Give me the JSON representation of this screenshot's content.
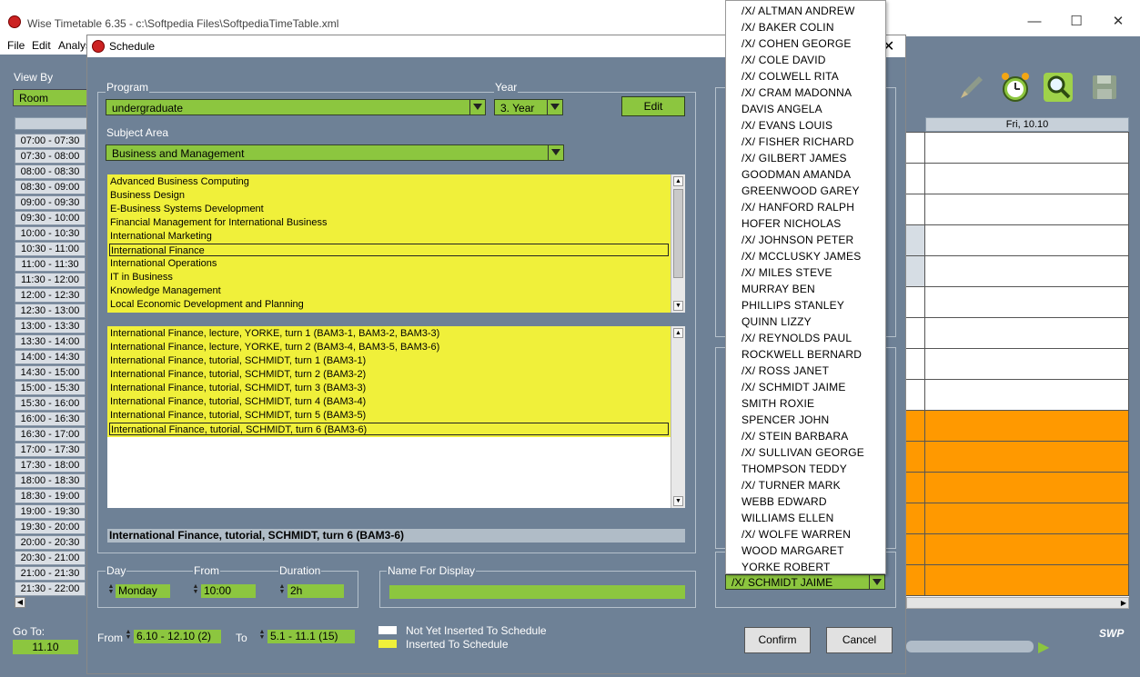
{
  "main_window": {
    "title": "Wise Timetable 6.35 - c:\\Softpedia Files\\SoftpediaTimeTable.xml",
    "menu": [
      "File",
      "Edit",
      "Analys"
    ],
    "view_by_label": "View By",
    "view_by_value": "Room",
    "time_slots": [
      "07:00 - 07:30",
      "07:30 - 08:00",
      "08:00 - 08:30",
      "08:30 - 09:00",
      "09:00 - 09:30",
      "09:30 - 10:00",
      "10:00 - 10:30",
      "10:30 - 11:00",
      "11:00 - 11:30",
      "11:30 - 12:00",
      "12:00 - 12:30",
      "12:30 - 13:00",
      "13:00 - 13:30",
      "13:30 - 14:00",
      "14:00 - 14:30",
      "14:30 - 15:00",
      "15:00 - 15:30",
      "15:30 - 16:00",
      "16:00 - 16:30",
      "16:30 - 17:00",
      "17:00 - 17:30",
      "17:30 - 18:00",
      "18:00 - 18:30",
      "18:30 - 19:00",
      "19:00 - 19:30",
      "19:30 - 20:00",
      "20:00 - 20:30",
      "20:30 - 21:00",
      "21:00 - 21:30",
      "21:30 - 22:00"
    ],
    "day_header": "Fri, 10.10",
    "goto_label": "Go To:",
    "goto_value": "11.10",
    "logo": "SWP",
    "colors": {
      "accent_green": "#8cc63f",
      "scheduled_orange": "#ff9900",
      "background": "#6f8196"
    }
  },
  "dialog": {
    "title": "Schedule",
    "program_label": "Program",
    "program_value": "undergraduate",
    "year_label": "Year",
    "year_value": "3. Year",
    "edit_label": "Edit",
    "subject_area_label": "Subject Area",
    "subject_area_value": "Business and Management",
    "courses": [
      "Advanced Business Computing",
      "Business Design",
      "E-Business Systems Development",
      "Financial Management for International Business",
      "International Marketing",
      "International Finance",
      "International Operations",
      "IT in Business",
      "Knowledge Management",
      "Local Economic Development and Planning"
    ],
    "selected_course": "International Finance",
    "activities": [
      "International Finance, lecture, YORKE, turn 1 (BAM3-1, BAM3-2, BAM3-3)",
      "International Finance, lecture, YORKE, turn 2 (BAM3-4, BAM3-5, BAM3-6)",
      "International Finance, tutorial, SCHMIDT, turn 1 (BAM3-1)",
      "International Finance, tutorial, SCHMIDT, turn 2 (BAM3-2)",
      "International Finance, tutorial, SCHMIDT, turn 3 (BAM3-3)",
      "International Finance, tutorial, SCHMIDT, turn 4 (BAM3-4)",
      "International Finance, tutorial, SCHMIDT, turn 5 (BAM3-5)",
      "International Finance, tutorial, SCHMIDT, turn 6 (BAM3-6)"
    ],
    "selected_activity": "International Finance, tutorial, SCHMIDT, turn 6 (BAM3-6)",
    "day_label": "Day",
    "day_value": "Monday",
    "from_label": "From",
    "from_value": "10:00",
    "duration_label": "Duration",
    "duration_value": "2h",
    "name_for_display_label": "Name For Display",
    "name_for_display_value": "",
    "range_from_label": "From",
    "range_from_value": "6.10 - 12.10 (2)",
    "range_to_label": "To",
    "range_to_value": "5.1 - 11.1 (15)",
    "legend_not_inserted": "Not Yet Inserted To Schedule",
    "legend_inserted": "Inserted To Schedule",
    "teacher_value": "/X/ SCHMIDT JAIME",
    "confirm_label": "Confirm",
    "cancel_label": "Cancel"
  },
  "teacher_dropdown": [
    "/X/ ALTMAN ANDREW",
    "/X/ BAKER COLIN",
    "/X/ COHEN GEORGE",
    "/X/ COLE DAVID",
    "/X/ COLWELL RITA",
    "/X/ CRAM MADONNA",
    "DAVIS ANGELA",
    "/X/ EVANS LOUIS",
    "/X/ FISHER RICHARD",
    "/X/ GILBERT JAMES",
    "GOODMAN AMANDA",
    "GREENWOOD GAREY",
    "/X/ HANFORD RALPH",
    "HOFER NICHOLAS",
    "/X/ JOHNSON PETER",
    "/X/ MCCLUSKY JAMES",
    "/X/ MILES STEVE",
    "MURRAY BEN",
    "PHILLIPS STANLEY",
    "QUINN LIZZY",
    "/X/ REYNOLDS PAUL",
    "ROCKWELL BERNARD",
    "/X/ ROSS JANET",
    "/X/ SCHMIDT JAIME",
    "SMITH ROXIE",
    "SPENCER JOHN",
    "/X/ STEIN BARBARA",
    "/X/ SULLIVAN GEORGE",
    "THOMPSON TEDDY",
    "/X/ TURNER MARK",
    "WEBB EDWARD",
    "WILLIAMS ELLEN",
    "/X/ WOLFE WARREN",
    "WOOD MARGARET",
    "YORKE ROBERT"
  ]
}
